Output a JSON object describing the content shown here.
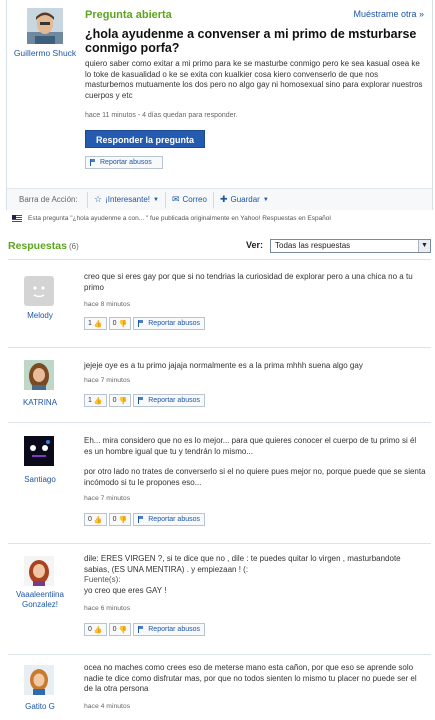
{
  "question": {
    "status": "Pregunta abierta",
    "show_more": "Muéstrame otra »",
    "asker": "Guillermo Shuck",
    "title": "¿hola ayudenme a convenser a mi primo de msturbarse conmigo porfa?",
    "body": "quiero saber como exitar a mi primo para ke se masturbe conmigo pero ke sea kasual osea ke lo toke de kasualidad o ke se exita con kualkier cosa kiero convenserlo de que nos masturbemos mutuamente los dos pero no algo gay ni homosexual sino para explorar nuestros cuerpos y etc",
    "meta": "hace 11 minutos - 4 días quedan para responder.",
    "answer_button": "Responder la pregunta",
    "report": "Reportar abusos"
  },
  "action_bar": {
    "label": "Barra de Acción:",
    "interesting": "¡Interesante!",
    "mail": "Correo",
    "save": "Guardar"
  },
  "origin_note": "Esta pregunta \"¿hola ayudenme a con... \" fue publicada originalmente en Yahoo! Respuestas en Español",
  "answers_header": {
    "title": "Respuestas",
    "count": "(6)",
    "filter_label": "Ver:",
    "filter_value": "Todas las respuestas"
  },
  "answers": [
    {
      "user": "Melody",
      "text": "creo que si eres gay por que si no tendrias la curiosidad de explorar pero a una chica no a tu primo",
      "time": "hace 8 minutos",
      "up": "1",
      "down": "0",
      "report": "Reportar abusos"
    },
    {
      "user": "KATRINA",
      "text": "jejeje oye es a tu primo jajaja normalmente es a la prima mhhh suena algo gay",
      "time": "hace 7 minutos",
      "up": "1",
      "down": "0",
      "report": "Reportar abusos"
    },
    {
      "user": "Santiago",
      "text": "Eh... mira considero que no es lo mejor... para que quieres conocer el cuerpo de tu primo si él es un hombre igual que tu y tendrán lo mismo...",
      "text2": "por otro lado no trates de converserlo si el no quiere pues mejor no, porque puede que se sienta incómodo si tu le propones eso...",
      "time": "hace 7 minutos",
      "up": "0",
      "down": "0",
      "report": "Reportar abusos"
    },
    {
      "user": "Vaaaleentiina Gonzalez!",
      "text": "dile: ERES VIRGEN ?, si te dice que no , dile : te puedes quitar lo virgen , masturbandote sabias, (ES UNA MENTIRA) . y empiezaan ! (:",
      "source_label": "Fuente(s):",
      "source": "yo creo que eres GAY !",
      "time": "hace 6 minutos",
      "up": "0",
      "down": "0",
      "report": "Reportar abusos"
    },
    {
      "user": "Gatito G",
      "text": "ocea no maches como crees eso de meterse mano esta cañon, por que eso se aprende solo nadie te dice como disfrutar mas, por que no todos sienten lo mismo tu placer no puede ser el de la otra persona",
      "time": "hace 4 minutos"
    }
  ]
}
